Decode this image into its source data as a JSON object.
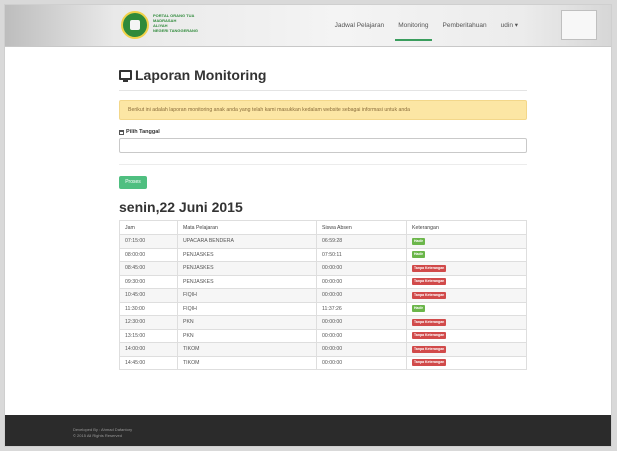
{
  "brand": {
    "lines": [
      "PORTAL ORANG TUA",
      "MADRASAH",
      "ALIYAH",
      "NEGERI TANGGERANG"
    ]
  },
  "nav": {
    "items": [
      {
        "label": "Jadwal Pelajaran",
        "active": false
      },
      {
        "label": "Monitoring",
        "active": true
      },
      {
        "label": "Pemberitahuan",
        "active": false
      },
      {
        "label": "udin ▾",
        "active": false
      }
    ]
  },
  "page": {
    "title": "Laporan Monitoring",
    "alert": "Berikut ini adalah laporan monitoring anak anda yang telah kami masukkan kedalam website sebagai informasi untuk anda",
    "date_label": "Pilih Tanggal",
    "date_value": "",
    "submit_label": "Proses",
    "day_heading": "senin,22 Juni 2015"
  },
  "table": {
    "headers": [
      "Jam",
      "Mata Pelajaran",
      "Siswa Absen",
      "Keterangan"
    ],
    "rows": [
      {
        "jam": "07:15:00",
        "mapel": "UPACARA BENDERA",
        "absen": "06:59:28",
        "ket": "Hadir",
        "status": "present"
      },
      {
        "jam": "08:00:00",
        "mapel": "PENJASKES",
        "absen": "07:50:11",
        "ket": "Hadir",
        "status": "present"
      },
      {
        "jam": "08:45:00",
        "mapel": "PENJASKES",
        "absen": "00:00:00",
        "ket": "Tanpa Keterangan",
        "status": "absent"
      },
      {
        "jam": "09:30:00",
        "mapel": "PENJASKES",
        "absen": "00:00:00",
        "ket": "Tanpa Keterangan",
        "status": "absent"
      },
      {
        "jam": "10:45:00",
        "mapel": "FIQIH",
        "absen": "00:00:00",
        "ket": "Tanpa Keterangan",
        "status": "absent"
      },
      {
        "jam": "11:30:00",
        "mapel": "FIQIH",
        "absen": "11:37:26",
        "ket": "Hadir",
        "status": "present"
      },
      {
        "jam": "12:30:00",
        "mapel": "PKN",
        "absen": "00:00:00",
        "ket": "Tanpa Keterangan",
        "status": "absent"
      },
      {
        "jam": "13:15:00",
        "mapel": "PKN",
        "absen": "00:00:00",
        "ket": "Tanpa Keterangan",
        "status": "absent"
      },
      {
        "jam": "14:00:00",
        "mapel": "TIKOM",
        "absen": "00:00:00",
        "ket": "Tanpa Keterangan",
        "status": "absent"
      },
      {
        "jam": "14:45:00",
        "mapel": "TIKOM",
        "absen": "00:00:00",
        "ket": "Tanpa Keterangan",
        "status": "absent"
      }
    ]
  },
  "footer": {
    "line1": "Developed By : Ahmad Dafantory",
    "line2": "© 2015 All Rights Reserved"
  },
  "colors": {
    "accent": "#3a9d5d",
    "present_badge": "#6bb64a",
    "absent_badge": "#d14a4a",
    "alert_bg": "#fce6a4",
    "footer_bg": "#2b2b2b"
  },
  "icons": {
    "title": "monitor-icon",
    "date": "calendar-icon"
  }
}
